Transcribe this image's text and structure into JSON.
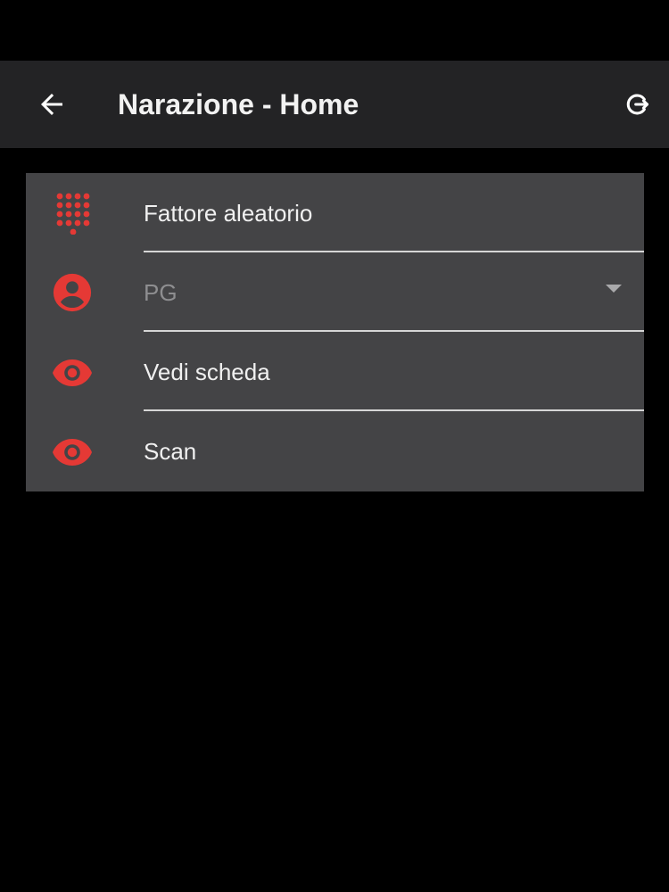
{
  "app_bar": {
    "title": "Narazione - Home",
    "back_icon": "arrow-left-icon",
    "logout_icon": "logout-icon"
  },
  "menu": {
    "accent_color": "#e53935",
    "items": [
      {
        "label": "Fattore aleatorio",
        "icon": "dialpad-icon"
      },
      {
        "label": "PG",
        "icon": "account-circle-icon",
        "is_placeholder": true,
        "has_dropdown": true
      },
      {
        "label": "Vedi scheda",
        "icon": "eye-icon"
      },
      {
        "label": "Scan",
        "icon": "eye-icon"
      }
    ]
  }
}
